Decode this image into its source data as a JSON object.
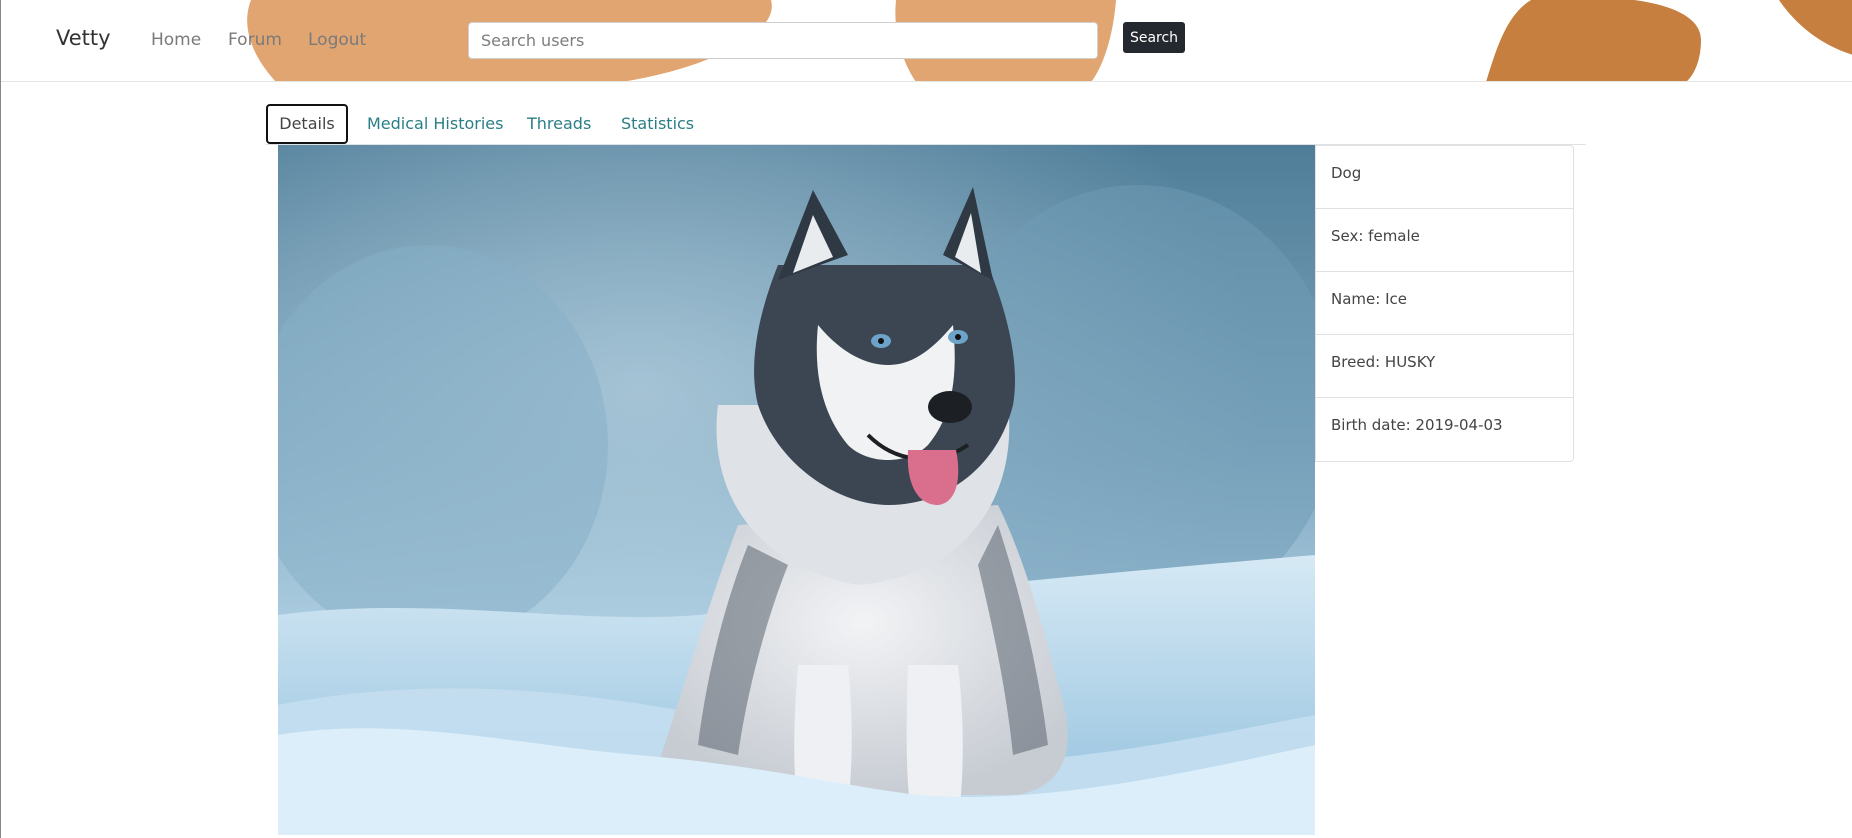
{
  "navbar": {
    "brand": "Vetty",
    "links": {
      "home": "Home",
      "forum": "Forum",
      "logout": "Logout"
    },
    "search": {
      "placeholder": "Search users",
      "value": "",
      "button_label": "Search"
    }
  },
  "tabs": [
    {
      "label": "Details",
      "active": true
    },
    {
      "label": "Medical Histories",
      "active": false
    },
    {
      "label": "Threads",
      "active": false
    },
    {
      "label": "Statistics",
      "active": false
    }
  ],
  "pet": {
    "photo_subject": "husky dog in snow",
    "details": [
      "Dog",
      "Sex: female",
      "Name: Ice",
      "Breed: HUSKY",
      "Birth date: 2019-04-03"
    ]
  },
  "colors": {
    "blob_light": "#e1a571",
    "blob_dark": "#c67f3e",
    "tab_link": "#2a7f86",
    "search_button_bg": "#24292f"
  }
}
